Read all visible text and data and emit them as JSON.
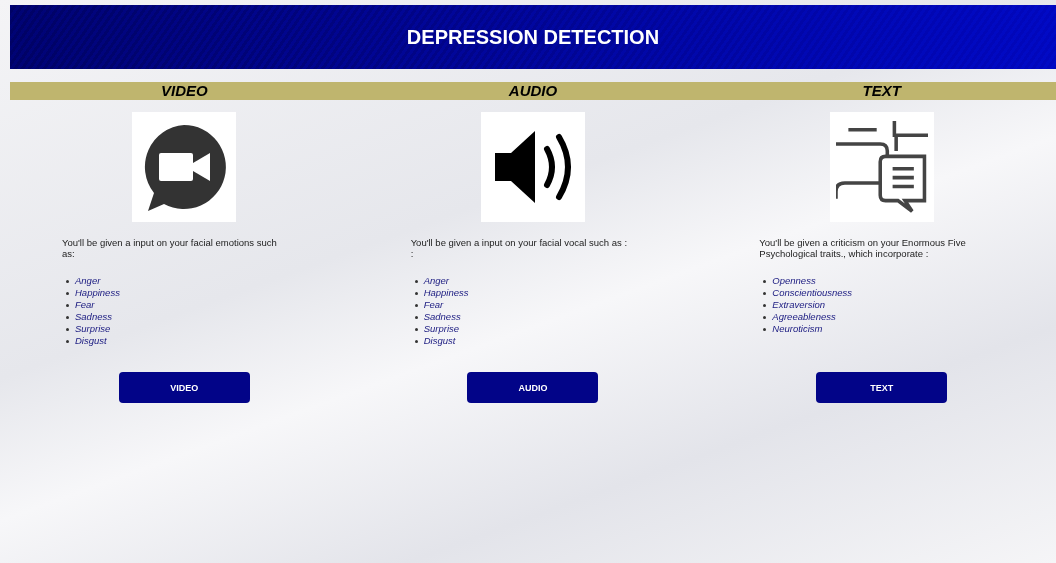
{
  "header": {
    "title": "DEPRESSION DETECTION"
  },
  "sections": [
    {
      "heading": "VIDEO",
      "kind": "video",
      "description": "You'll be given a input on your facial emotions such as:",
      "items": [
        "Anger",
        "Happiness",
        "Fear",
        "Sadness",
        "Surprise",
        "Disgust"
      ],
      "button": "VIDEO"
    },
    {
      "heading": "AUDIO",
      "kind": "audio",
      "description": "You'll be given a input on your facial vocal such as : :",
      "items": [
        "Anger",
        "Happiness",
        "Fear",
        "Sadness",
        "Surprise",
        "Disgust"
      ],
      "button": "AUDIO"
    },
    {
      "heading": "TEXT",
      "kind": "text",
      "description": "You'll be given a criticism on your Enormous Five Psychological traits., which incorporate :",
      "items": [
        "Openness",
        "Conscientiousness",
        "Extraversion",
        "Agreeableness",
        "Neuroticism"
      ],
      "button": "TEXT"
    }
  ]
}
